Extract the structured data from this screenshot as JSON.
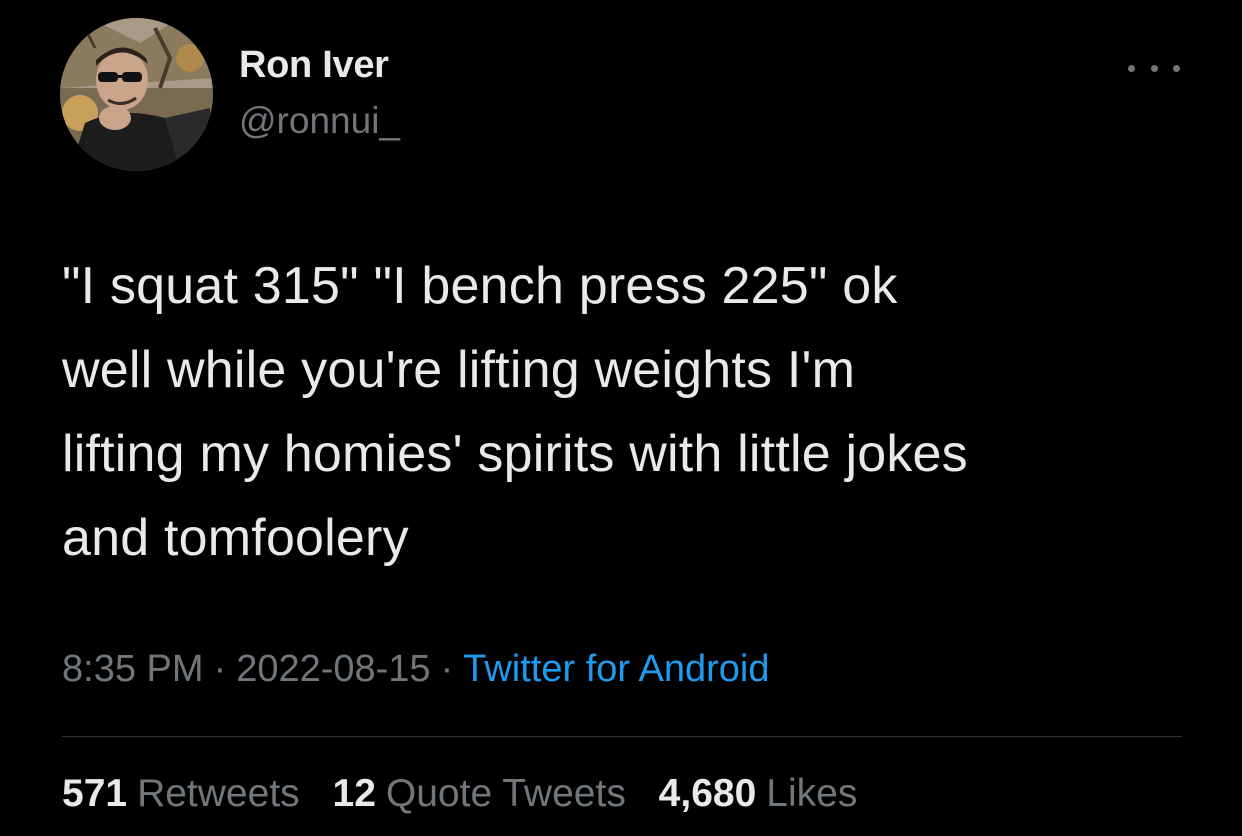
{
  "user": {
    "display_name": "Ron Iver",
    "handle": "@ronnui_",
    "avatar_icon": "profile-photo"
  },
  "more_icon": "more-horizontal-icon",
  "tweet": {
    "text": "\"I squat 315\" \"I bench press 225\" ok\nwell while you're lifting weights I'm\nlifting my homies' spirits with little jokes\nand tomfoolery"
  },
  "meta": {
    "time": "8:35 PM",
    "separator": "·",
    "date": "2022-08-15",
    "source": "Twitter for Android"
  },
  "stats": {
    "retweets": {
      "count": "571",
      "label": "Retweets"
    },
    "quote_tweets": {
      "count": "12",
      "label": "Quote Tweets"
    },
    "likes": {
      "count": "4,680",
      "label": "Likes"
    }
  },
  "colors": {
    "background": "#000000",
    "primary_text": "#e7e9ea",
    "secondary_text": "#71767b",
    "link": "#1d9bf0",
    "divider": "#2f3336"
  }
}
